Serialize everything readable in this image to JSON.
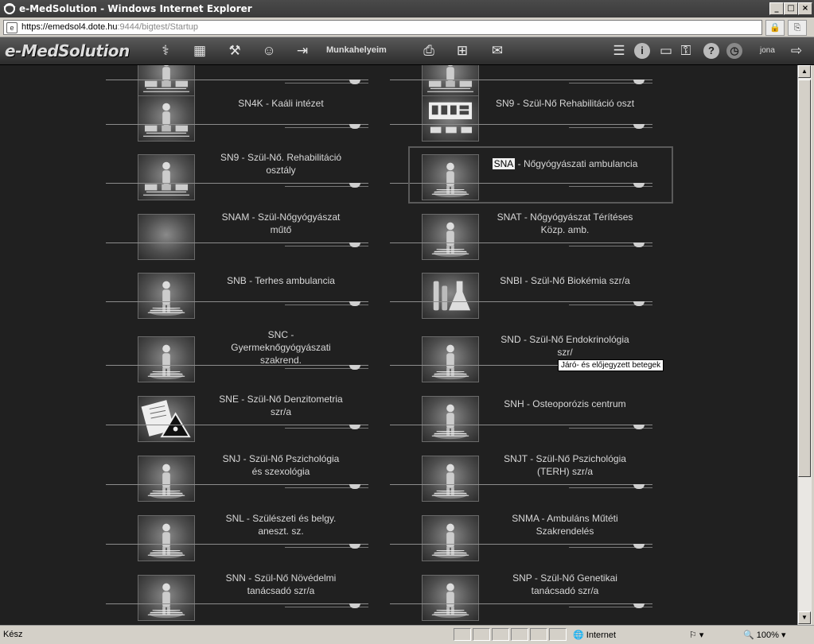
{
  "window": {
    "title": "e-MedSolution - Windows Internet Explorer"
  },
  "address": {
    "scheme_host": "https://emedsol4.",
    "domain": "dote.hu",
    "rest": ":9444/bigtest/Startup"
  },
  "app": {
    "logo": "e-MedSolution",
    "toolbar_label": "Munkahelyeim",
    "user": "jona"
  },
  "tiles": [
    {
      "id": "top-left-partial",
      "label": "",
      "icon": "bed-person"
    },
    {
      "id": "top-right-partial",
      "label": "",
      "icon": "bed-person"
    },
    {
      "id": "SN4K",
      "label": "SN4K - Kaáli intézet",
      "icon": "bed-person"
    },
    {
      "id": "SN9",
      "label": "SN9 - Szül-Nő Rehabilitáció oszt",
      "icon": "ward-beds"
    },
    {
      "id": "SN9b",
      "label_lines": [
        "SN9 - Szül-Nő. Rehabilitáció",
        "osztály"
      ],
      "icon": "bed-person"
    },
    {
      "id": "SNA",
      "code": "SNA",
      "rest": " - Nőgyógyászati ambulancia",
      "icon": "person"
    },
    {
      "id": "SNAM",
      "label_lines": [
        "SNAM - Szül-Nőgyógyászat",
        "műtő"
      ],
      "icon": "blank"
    },
    {
      "id": "SNAT",
      "label_lines": [
        "SNAT - Nőgyógyászat Térítéses",
        "Közp. amb."
      ],
      "icon": "person"
    },
    {
      "id": "SNB",
      "label": "SNB - Terhes ambulancia",
      "icon": "person"
    },
    {
      "id": "SNBI",
      "label": "SNBI - Szül-Nő Biokémia szr/a",
      "icon": "lab"
    },
    {
      "id": "SNC",
      "label_lines": [
        "SNC -",
        "Gyermeknőgyógyászati",
        "szakrend."
      ],
      "icon": "person"
    },
    {
      "id": "SND",
      "label_lines": [
        "SND - Szül-Nő Endokrinológia",
        "szr/"
      ],
      "icon": "person"
    },
    {
      "id": "SNE",
      "label_lines": [
        "SNE - Szül-Nő Denzitometria",
        "szr/a"
      ],
      "icon": "radiation"
    },
    {
      "id": "SNH",
      "label": "SNH - Osteoporózis centrum",
      "icon": "person"
    },
    {
      "id": "SNJ",
      "label_lines": [
        "SNJ - Szül-Nő Pszichológia",
        "és szexológia"
      ],
      "icon": "person"
    },
    {
      "id": "SNJT",
      "label_lines": [
        "SNJT - Szül-Nő Pszichológia",
        "(TERH) szr/a"
      ],
      "icon": "person"
    },
    {
      "id": "SNL",
      "label_lines": [
        "SNL - Szülészeti és belgy.",
        "aneszt. sz."
      ],
      "icon": "person"
    },
    {
      "id": "SNMA",
      "label_lines": [
        "SNMA - Ambuláns Műtéti",
        "Szakrendelés"
      ],
      "icon": "person"
    },
    {
      "id": "SNN",
      "label_lines": [
        "SNN - Szül-Nő Növédelmi",
        "tanácsadó szr/a"
      ],
      "icon": "person"
    },
    {
      "id": "SNP",
      "label_lines": [
        "SNP - Szül-Nő Genetikai",
        "tanácsadó szr/a"
      ],
      "icon": "person"
    }
  ],
  "tooltip": "Járó- és előjegyzett betegek",
  "statusbar": {
    "text": "Kész",
    "zone": "Internet",
    "zoom": "100%"
  }
}
